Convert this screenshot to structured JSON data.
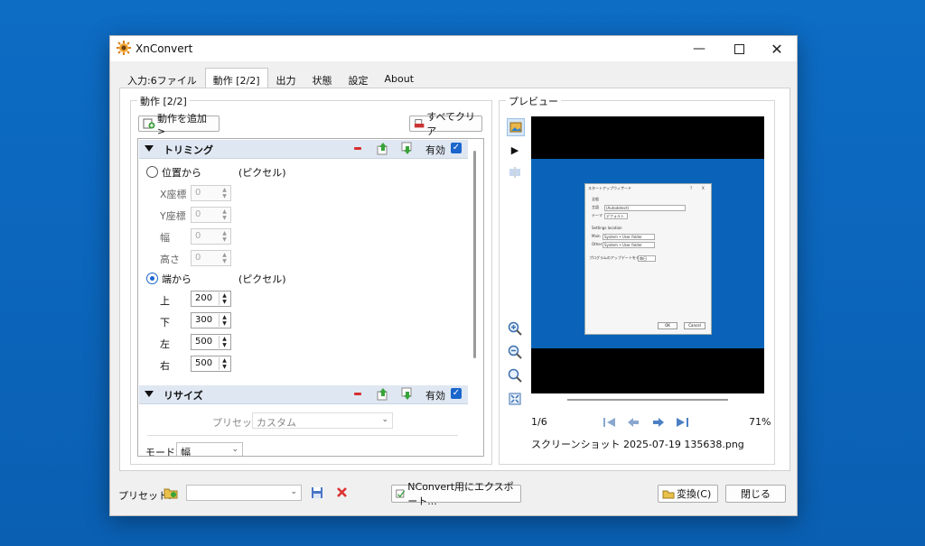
{
  "window": {
    "title": "XnConvert"
  },
  "tabs": [
    {
      "label": "入力:6ファイル",
      "active": false
    },
    {
      "label": "動作 [2/2]",
      "active": true
    },
    {
      "label": "出力",
      "active": false
    },
    {
      "label": "状態",
      "active": false
    },
    {
      "label": "設定",
      "active": false
    },
    {
      "label": "About",
      "active": false
    }
  ],
  "actions_group": {
    "title": "動作 [2/2]",
    "add_button": "動作を追加>",
    "clear_button": "すべてクリア"
  },
  "trim": {
    "header": "トリミング",
    "enabled_label": "有効",
    "enabled": true,
    "by_position_label": "位置から",
    "by_position_selected": false,
    "pixel_unit_1": "(ピクセル)",
    "x_label": "X座標",
    "x_value": "0",
    "y_label": "Y座標",
    "y_value": "0",
    "w_label": "幅",
    "w_value": "0",
    "h_label": "高さ",
    "h_value": "0",
    "by_edge_label": "端から",
    "by_edge_selected": true,
    "pixel_unit_2": "(ピクセル)",
    "top_label": "上",
    "top_value": "200",
    "bottom_label": "下",
    "bottom_value": "300",
    "left_label": "左",
    "left_value": "500",
    "right_label": "右",
    "right_value": "500"
  },
  "resize": {
    "header": "リサイズ",
    "enabled_label": "有効",
    "enabled": true,
    "preset_label": "プリセット",
    "preset_value": "カスタム",
    "mode_label": "モード",
    "mode_value": "幅"
  },
  "preview": {
    "title": "プレビュー",
    "counter": "1/6",
    "zoom": "71%",
    "filename": "スクリーンショット 2025-07-19 135638.png",
    "inner_dialog": {
      "title": "スタートアップウィザード",
      "help": "?",
      "close": "X",
      "general": "全般",
      "lang_label": "言語",
      "lang_value": "(Autodetect)",
      "theme_label": "テーマ",
      "theme_value": "デフォルト",
      "settings_location": "Settings location",
      "main_label": "Main",
      "main_value": "System • User folder",
      "other_label": "Other",
      "other_value": "System • User folder",
      "update_label": "プログラムのアップデートをチェック",
      "update_value": "毎日",
      "ok": "OK",
      "cancel": "Cancel"
    }
  },
  "footer": {
    "preset_label": "プリセット:",
    "export_button": "NConvert用にエクスポート...",
    "convert_button": "変換(C)",
    "close_button": "閉じる"
  },
  "colors": {
    "desktop": "#0a63b8",
    "accent": "#1a66cc",
    "section_header": "#dfe7f2"
  }
}
